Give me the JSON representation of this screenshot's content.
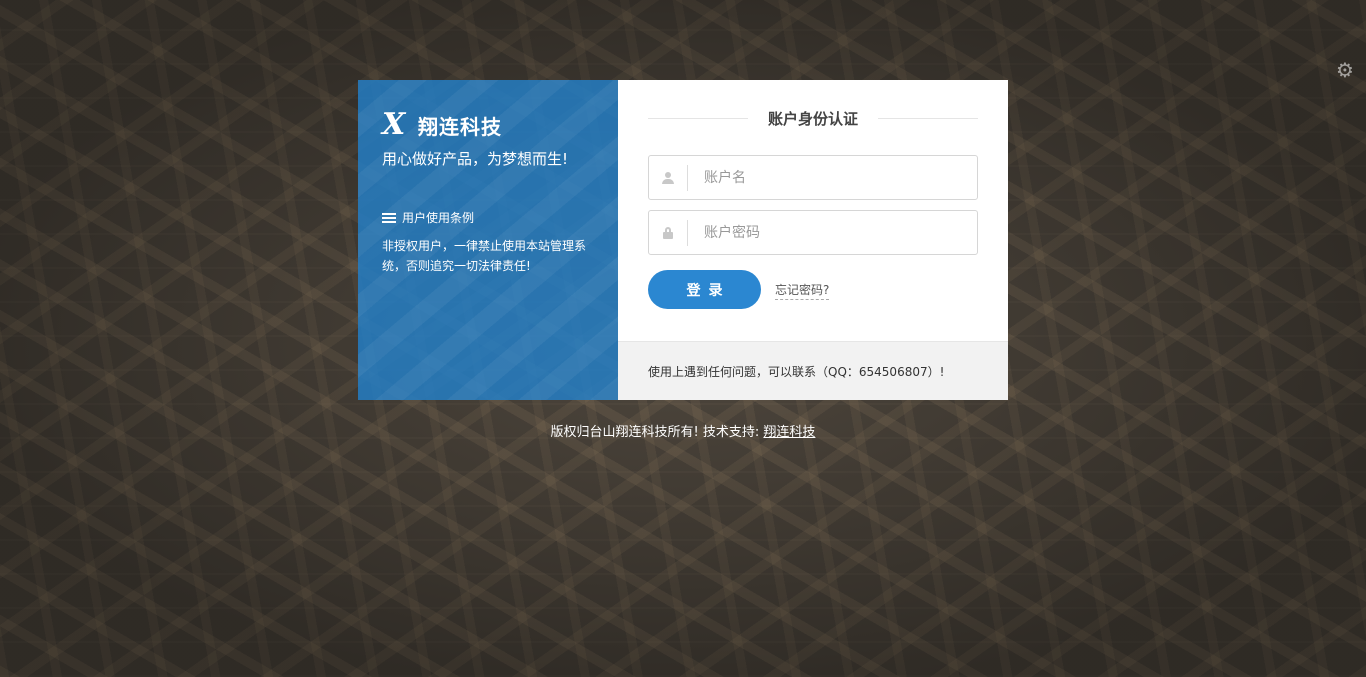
{
  "brand": {
    "logo_glyph": "X",
    "name": "翔连科技",
    "slogan": "用心做好产品，为梦想而生!"
  },
  "terms": {
    "title": "用户使用条例",
    "text": "非授权用户，一律禁止使用本站管理系统，否则追究一切法律责任!"
  },
  "form": {
    "title": "账户身份认证",
    "username_placeholder": "账户名",
    "username_value": "",
    "password_placeholder": "账户密码",
    "password_value": "",
    "login_label": "登录",
    "forgot_label": "忘记密码?"
  },
  "help": {
    "text": "使用上遇到任何问题，可以联系（QQ：654506807）!"
  },
  "footer": {
    "copyright": "版权归台山翔连科技所有! 技术支持:",
    "support_link": "翔连科技"
  },
  "icons": {
    "settings": "gears-icon",
    "username": "user-icon",
    "password": "lock-icon",
    "terms": "list-icon"
  },
  "colors": {
    "primary": "#2b87d1",
    "left_panel": "#2380c9",
    "help_bar": "#f2f2f2"
  }
}
